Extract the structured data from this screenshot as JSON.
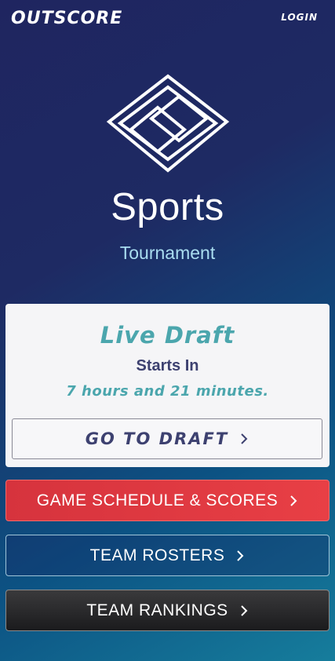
{
  "header": {
    "brand": "OUTSCORE",
    "login_label": "LOGIN"
  },
  "hero": {
    "title": "Sports",
    "subtitle": "Tournament",
    "logo_icon": "nested-diamond-logo"
  },
  "draft_card": {
    "title": "Live Draft",
    "subtitle": "Starts In",
    "countdown": "7 hours and 21 minutes.",
    "button_label": "GO TO DRAFT"
  },
  "actions": {
    "schedule_label": "GAME SCHEDULE & SCORES",
    "rosters_label": "TEAM ROSTERS",
    "rankings_label": "TEAM RANKINGS"
  },
  "colors": {
    "accent_teal": "#4ba6ad",
    "navy_text": "#3d4170",
    "red_button": "#e03a41"
  }
}
